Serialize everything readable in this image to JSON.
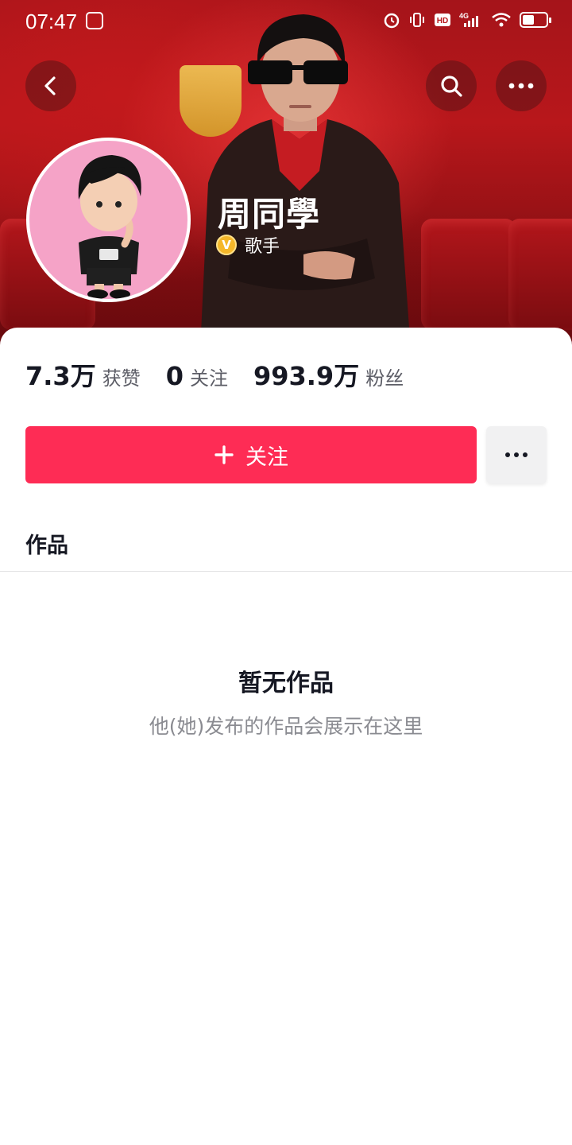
{
  "status_bar": {
    "time": "07:47",
    "icons": [
      "screenshot-icon",
      "alarm-icon",
      "vibrate-icon",
      "hd-icon",
      "4g-signal-icon",
      "wifi-icon",
      "battery-icon"
    ],
    "hd_label": "HD",
    "network_label": "4G"
  },
  "header": {
    "back_icon": "chevron-left-icon",
    "search_icon": "search-icon",
    "more_icon": "more-horizontal-icon"
  },
  "profile": {
    "name": "周同學",
    "verified_badge": "V",
    "verified_label": "歌手"
  },
  "stats": [
    {
      "value": "7.3万",
      "label": "获赞"
    },
    {
      "value": "0",
      "label": "关注"
    },
    {
      "value": "993.9万",
      "label": "粉丝"
    }
  ],
  "actions": {
    "follow_label": "关注",
    "follow_icon": "plus-icon",
    "more_icon": "more-horizontal-icon"
  },
  "tabs": {
    "works": "作品"
  },
  "empty_state": {
    "title": "暂无作品",
    "subtitle": "他(她)发布的作品会展示在这里"
  },
  "colors": {
    "accent": "#fe2c55",
    "banner_red": "#b8171b",
    "verify_gold": "#f5b72a",
    "avatar_bg": "#f5a3c7"
  }
}
